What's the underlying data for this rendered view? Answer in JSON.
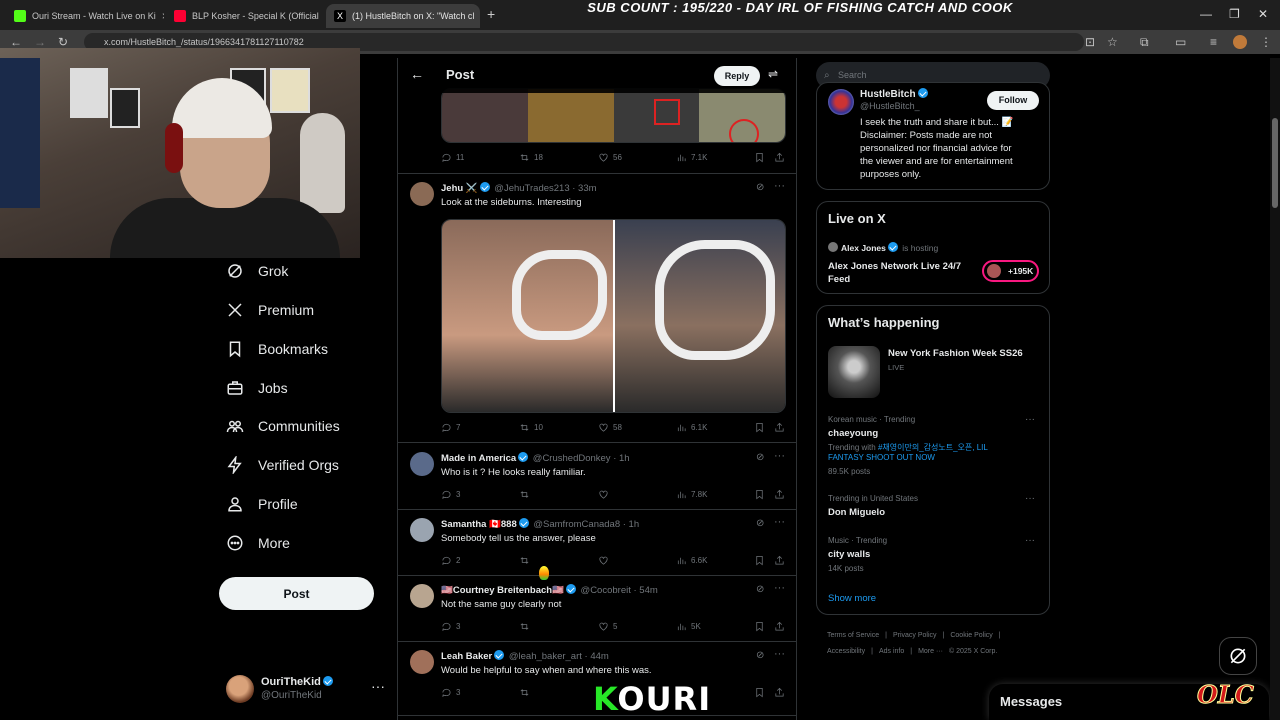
{
  "browser": {
    "tabs": [
      {
        "title": "Ouri Stream - Watch Live on Ki",
        "color": "#53fc18"
      },
      {
        "title": "BLP Kosher - Special K (Official",
        "color": "#ff0033"
      },
      {
        "title": "(1) HustleBitch on X: \"Watch cl",
        "color": "#ffffff"
      }
    ],
    "new_tab": "+",
    "url": "x.com/HustleBitch_/status/1966341781127110782"
  },
  "overlay": {
    "sub_count": "SUB COUNT : 195/220 - DAY IRL OF FISHING CATCH AND COOK",
    "kouri_k": "K",
    "kouri_rest": "OURI",
    "olc": "OLC"
  },
  "nav": {
    "items": [
      {
        "label": "Grok",
        "icon": "grok-icon"
      },
      {
        "label": "Premium",
        "icon": "x-logo-icon"
      },
      {
        "label": "Bookmarks",
        "icon": "bookmark-icon"
      },
      {
        "label": "Jobs",
        "icon": "briefcase-icon"
      },
      {
        "label": "Communities",
        "icon": "communities-icon"
      },
      {
        "label": "Verified Orgs",
        "icon": "lightning-icon"
      },
      {
        "label": "Profile",
        "icon": "person-icon"
      },
      {
        "label": "More",
        "icon": "more-circle-icon"
      }
    ],
    "post_label": "Post",
    "account": {
      "name": "OuriTheKid",
      "handle": "@OuriTheKid"
    }
  },
  "timeline": {
    "title": "Post",
    "reply_label": "Reply",
    "top_actions": {
      "replies": "11",
      "reposts": "18",
      "likes": "56",
      "views": "7.1K"
    },
    "tweets": [
      {
        "name": "Jehu ⚔️",
        "handle": "@JehuTrades213 · 33m",
        "text": "Look at the sideburns. Interesting",
        "replies": "7",
        "reposts": "10",
        "likes": "58",
        "views": "6.1K",
        "avatar": "#8a6a55"
      },
      {
        "name": "Made in America",
        "handle": "@CrushedDonkey · 1h",
        "text": "Who is it ?  He looks really familiar.",
        "replies": "3",
        "reposts": "",
        "likes": "",
        "views": "7.8K",
        "avatar": "#5a6a8a"
      },
      {
        "name": "Samantha 🇨🇦888",
        "handle": "@SamfromCanada8 · 1h",
        "text": "Somebody tell us the answer, please",
        "replies": "2",
        "reposts": "",
        "likes": "",
        "views": "6.6K",
        "avatar": "#9aa4b0"
      },
      {
        "name": "🇺🇸Courtney Breitenbach🇺🇸",
        "handle": "@Cocobreit · 54m",
        "text": "Not the same guy clearly not",
        "replies": "3",
        "reposts": "",
        "likes": "5",
        "views": "5K",
        "avatar": "#b8a590"
      },
      {
        "name": "Leah Baker",
        "handle": "@leah_baker_art · 44m",
        "text": "Would be helpful to say when and where this was.",
        "replies": "3",
        "reposts": "",
        "likes": "",
        "views": "",
        "avatar": "#a0705a"
      }
    ]
  },
  "right": {
    "search_placeholder": "Search",
    "profile": {
      "name": "HustleBitch",
      "handle": "@HustleBitch_",
      "follow_label": "Follow",
      "bio": [
        "I seek the truth and share it but... 📝",
        "Disclaimer: Posts made are not",
        "personalized nor financial advice for",
        "the viewer and are for entertainment",
        "purposes only."
      ]
    },
    "live": {
      "title": "Live on X",
      "host": "Alex Jones",
      "host_suffix": "is hosting",
      "stream_title": [
        "Alex Jones Network Live 24/7",
        "Feed"
      ],
      "count": "+195K"
    },
    "happening": {
      "title": "What’s happening",
      "feature_title": "New York Fashion Week SS26",
      "feature_status": "LIVE",
      "trends": [
        {
          "meta": "Korean music · Trending",
          "name": "chaeyoung",
          "extra1": "Trending with ",
          "extra_link": "#채영이만의_감성노트_오픈, LIL",
          "extra_link2": "FANTASY SHOOT OUT NOW",
          "posts": "89.5K posts"
        },
        {
          "meta": "Trending in United States",
          "name": "Don Miguelo",
          "posts": ""
        },
        {
          "meta": "Music · Trending",
          "name": "city walls",
          "posts": "14K posts"
        }
      ],
      "show_more": "Show more"
    },
    "footer": [
      "Terms of Service",
      "|",
      "Privacy Policy",
      "|",
      "Cookie Policy",
      "|",
      "Accessibility",
      "|",
      "Ads info",
      "|",
      "More ···",
      "© 2025 X Corp."
    ],
    "messages": "Messages"
  },
  "colors": {
    "accent": "#1d9bf0",
    "live_border": "#f91880"
  }
}
